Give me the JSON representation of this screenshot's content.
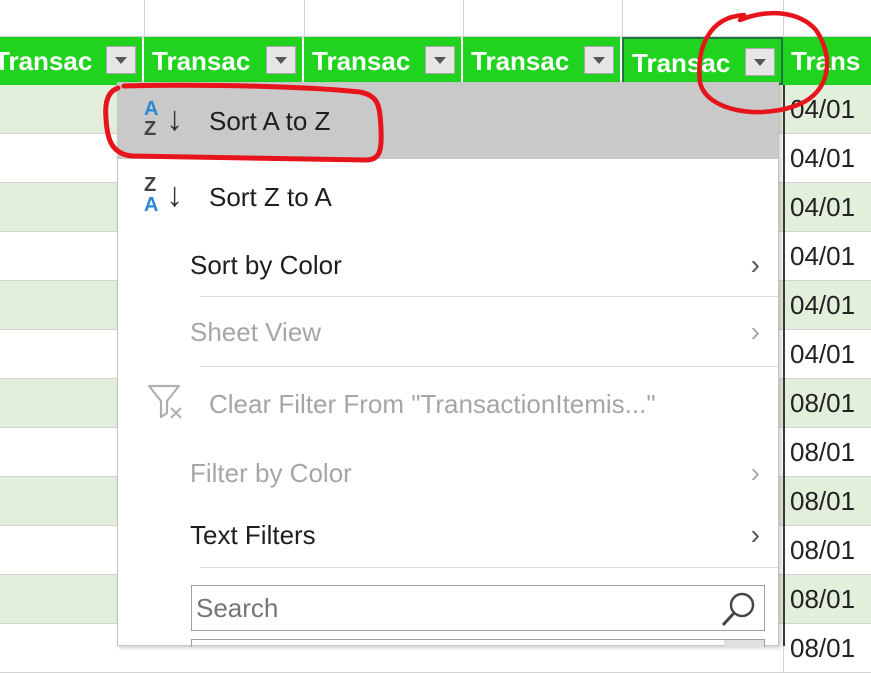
{
  "header": {
    "columns": [
      {
        "label": "Transac"
      },
      {
        "label": "Transac"
      },
      {
        "label": "Transac"
      },
      {
        "label": "Transac"
      },
      {
        "label": "Transac"
      },
      {
        "label": "Trans"
      }
    ]
  },
  "rows": [
    {
      "date": "04/01"
    },
    {
      "date": "04/01"
    },
    {
      "date": "04/01"
    },
    {
      "date": "04/01"
    },
    {
      "date": "04/01"
    },
    {
      "date": "04/01"
    },
    {
      "date": "08/01"
    },
    {
      "date": "08/01"
    },
    {
      "date": "08/01"
    },
    {
      "date": "08/01"
    },
    {
      "date": "08/01"
    },
    {
      "date": "08/01"
    }
  ],
  "menu": {
    "sort_az": "Sort A to Z",
    "sort_za": "Sort Z to A",
    "sort_by_color": "Sort by Color",
    "sheet_view": "Sheet View",
    "clear_filter": "Clear Filter From \"TransactionItemis...\"",
    "filter_by_color": "Filter by Color",
    "text_filters": "Text Filters",
    "search_placeholder": "Search",
    "icon_az_top": "A",
    "icon_az_bottom": "Z",
    "icon_za_top": "Z",
    "icon_za_bottom": "A",
    "submenu_arrow": "›"
  },
  "colors": {
    "header_green": "#1fd31f",
    "band_green": "#e2efda",
    "highlight": "#c9c9c9",
    "annotation_red": "#e8141b",
    "sort_blue": "#2b88d8"
  }
}
